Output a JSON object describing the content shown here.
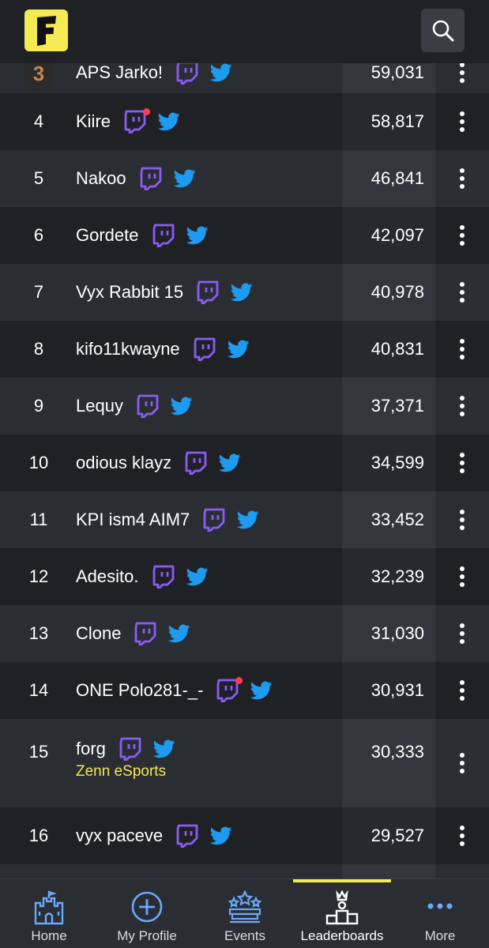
{
  "app": {
    "logo_letter": "F"
  },
  "colors": {
    "accent": "#f4ea52",
    "twitch": "#8a5cf5",
    "twitter": "#1d9bf0",
    "live": "#ff3c4c",
    "nav_icon": "#6aa8ff"
  },
  "leaderboard": {
    "rows": [
      {
        "rank": "3",
        "name": "APS Jarko!",
        "score": "59,031",
        "live": false,
        "team": null,
        "badge": "bronze"
      },
      {
        "rank": "4",
        "name": "Kiire",
        "score": "58,817",
        "live": true,
        "team": null
      },
      {
        "rank": "5",
        "name": "Nakoo",
        "score": "46,841",
        "live": false,
        "team": null
      },
      {
        "rank": "6",
        "name": "Gordete",
        "score": "42,097",
        "live": false,
        "team": null
      },
      {
        "rank": "7",
        "name": "Vyx Rabbit 15",
        "score": "40,978",
        "live": false,
        "team": null
      },
      {
        "rank": "8",
        "name": "kifo11kwayne",
        "score": "40,831",
        "live": false,
        "team": null
      },
      {
        "rank": "9",
        "name": "Lequy",
        "score": "37,371",
        "live": false,
        "team": null
      },
      {
        "rank": "10",
        "name": "odious klayz",
        "score": "34,599",
        "live": false,
        "team": null
      },
      {
        "rank": "11",
        "name": "KPI ism4 AIM7",
        "score": "33,452",
        "live": false,
        "team": null
      },
      {
        "rank": "12",
        "name": "Adesito.",
        "score": "32,239",
        "live": false,
        "team": null
      },
      {
        "rank": "13",
        "name": "Clone",
        "score": "31,030",
        "live": false,
        "team": null
      },
      {
        "rank": "14",
        "name": "ONE Polo281-_-",
        "score": "30,931",
        "live": true,
        "team": null
      },
      {
        "rank": "15",
        "name": "forg",
        "score": "30,333",
        "live": false,
        "team": "Zenn eSports"
      },
      {
        "rank": "16",
        "name": "vyx paceve",
        "score": "29,527",
        "live": false,
        "team": null
      },
      {
        "rank": "",
        "name": "",
        "score": "",
        "live": false,
        "team": null
      }
    ]
  },
  "nav": {
    "items": [
      {
        "label": "Home",
        "icon": "castle-icon"
      },
      {
        "label": "My Profile",
        "icon": "plus-circle-icon"
      },
      {
        "label": "Events",
        "icon": "stage-stars-icon"
      },
      {
        "label": "Leaderboards",
        "icon": "podium-icon"
      },
      {
        "label": "More",
        "icon": "more-dots-icon"
      }
    ],
    "active": "Leaderboards"
  }
}
